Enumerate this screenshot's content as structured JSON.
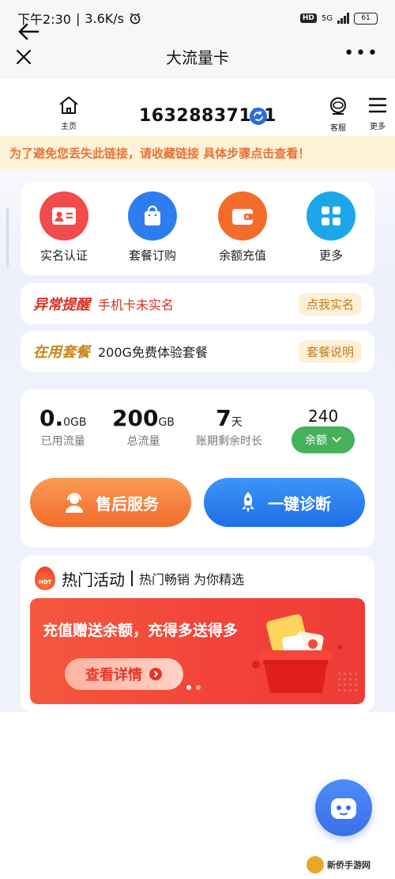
{
  "status_bar": {
    "time": "下午2:30",
    "sep": "|",
    "speed": "3.6K/s",
    "hd": "HD",
    "network": "5G",
    "battery": "61"
  },
  "nav": {
    "title": "大流量卡"
  },
  "header": {
    "home_label": "主页",
    "phone": "16328837111",
    "service_label": "客服",
    "more_label": "更多"
  },
  "notice": "为了避免您丢失此链接，请收藏链接 具体步骤点击查看！",
  "quick_actions": [
    {
      "label": "实名认证",
      "icon": "id-card-icon",
      "color": "#f24b4b"
    },
    {
      "label": "套餐订购",
      "icon": "shopping-bag-icon",
      "color": "#2e7df0"
    },
    {
      "label": "余额充值",
      "icon": "wallet-icon",
      "color": "#f46c2c"
    },
    {
      "label": "更多",
      "icon": "grid-icon",
      "color": "#1aa6e9"
    }
  ],
  "alert_row": {
    "title": "异常提醒",
    "text": "手机卡未实名",
    "button": "点我实名",
    "title_color": "#d93024"
  },
  "plan_row": {
    "title": "在用套餐",
    "text": "200G免费体验套餐",
    "button": "套餐说明",
    "title_color": "#c8861d"
  },
  "stats": {
    "used": {
      "num": "0.",
      "unit": "0GB",
      "caption": "已用流量"
    },
    "total": {
      "num": "200",
      "unit": "GB",
      "caption": "总流量"
    },
    "days": {
      "num": "7",
      "unit": "天",
      "caption": "账期剩余时长"
    },
    "balance": {
      "value": "240",
      "button": "余额"
    }
  },
  "buttons": {
    "after_sale": "售后服务",
    "diagnose": "一键诊断"
  },
  "hot": {
    "badge": "HOT",
    "title": "热门活动",
    "subtitle": "热门畅销 为你精选",
    "banner_text": "充值赠送余额，充得多送得多",
    "banner_button": "查看详情"
  },
  "watermark": "新侨手游网"
}
